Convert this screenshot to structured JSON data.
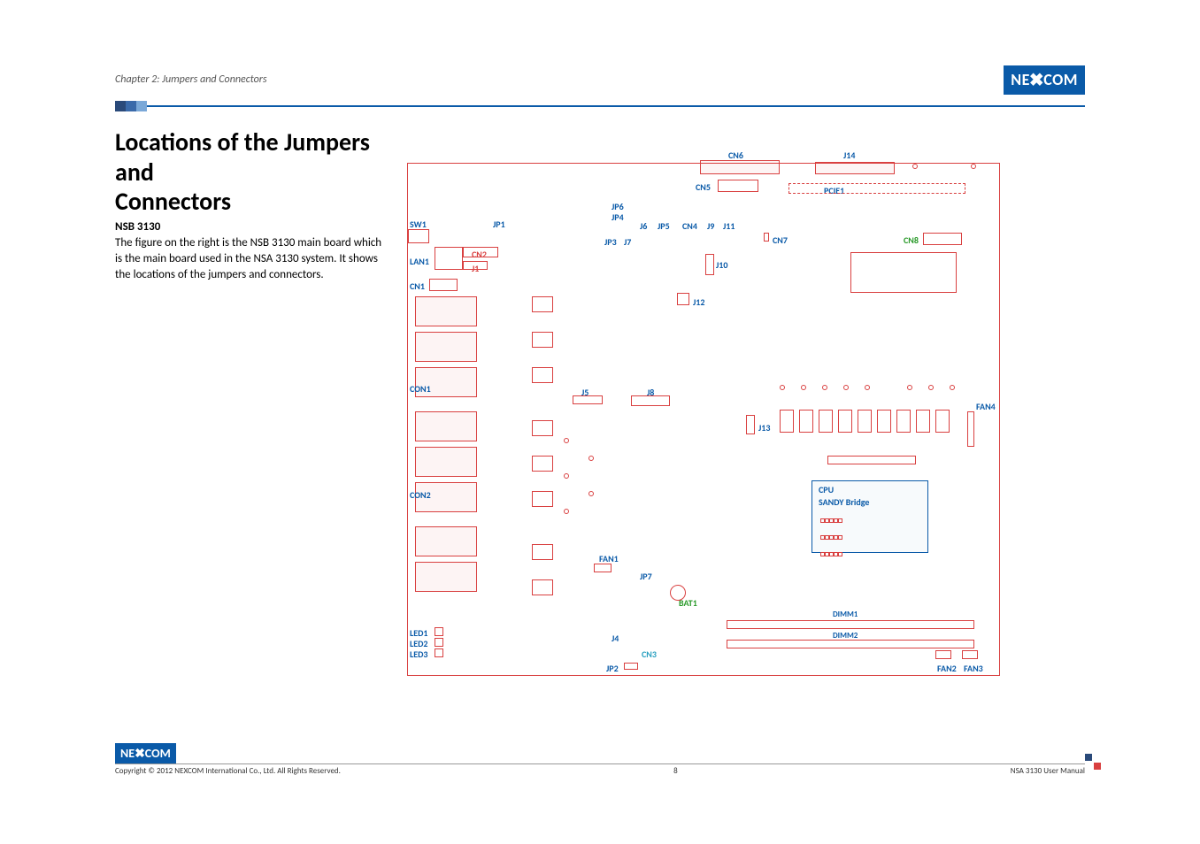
{
  "header": {
    "chapter": "Chapter 2: Jumpers and Connectors",
    "brand": "NEXCOM"
  },
  "title_line1": "Locations of the Jumpers and",
  "title_line2": "Connectors",
  "subtitle": "NSB 3130",
  "paragraph": "The figure on the right is the NSB 3130 main board which is the main board used in the NSA 3130 system. It shows the locations of the jumpers and connectors.",
  "board_labels": {
    "CN6": "CN6",
    "J14": "J14",
    "CN5": "CN5",
    "PCIE1": "PCIE1",
    "JP6": "JP6",
    "JP4": "JP4",
    "SW1": "SW1",
    "JP1": "JP1",
    "J6": "J6",
    "JP5": "JP5",
    "CN4": "CN4",
    "J9": "J9",
    "J11": "J11",
    "CN7": "CN7",
    "CN8": "CN8",
    "JP3": "JP3",
    "J7": "J7",
    "LAN1": "LAN1",
    "CN2": "CN2",
    "J1": "J1",
    "J10": "J10",
    "CN1": "CN1",
    "J12": "J12",
    "CON1": "CON1",
    "J5": "J5",
    "J8": "J8",
    "FAN4": "FAN4",
    "J13": "J13",
    "CON2": "CON2",
    "CPU": "CPU",
    "SANDY": "SANDY Bridge",
    "FAN1": "FAN1",
    "JP7": "JP7",
    "BAT1": "BAT1",
    "DIMM1": "DIMM1",
    "DIMM2": "DIMM2",
    "LED1": "LED1",
    "LED2": "LED2",
    "LED3": "LED3",
    "J4": "J4",
    "CN3": "CN3",
    "JP2": "JP2",
    "FAN2": "FAN2",
    "FAN3": "FAN3"
  },
  "footer": {
    "brand": "NEXCOM",
    "copyright": "Copyright © 2012 NEXCOM International Co., Ltd. All Rights Reserved.",
    "page_number": "8",
    "manual": "NSA 3130 User Manual"
  }
}
